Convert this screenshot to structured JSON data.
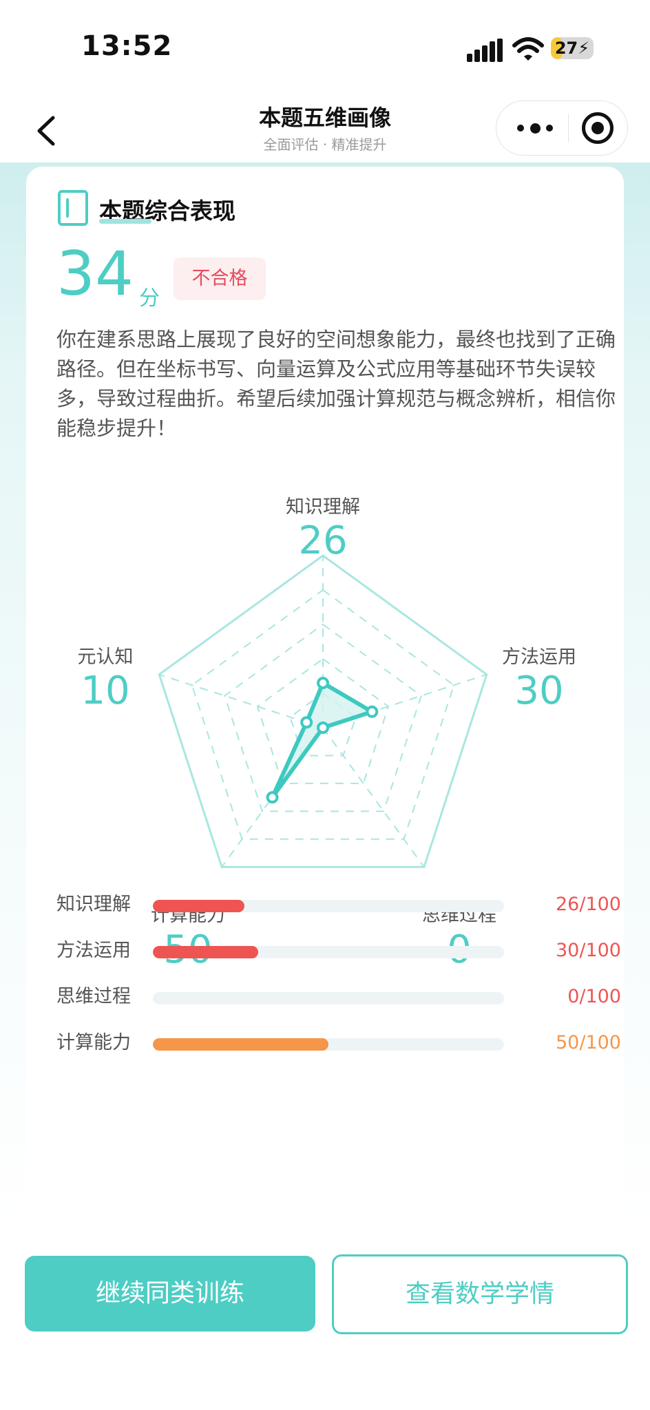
{
  "status_bar": {
    "time": "13:52",
    "battery": "27"
  },
  "nav": {
    "title": "本题五维画像",
    "subtitle": "全面评估 · 精准提升"
  },
  "summary": {
    "section_title": "本题综合表现",
    "score": "34",
    "score_unit": "分",
    "grade": "不合格",
    "comment": "你在建系思路上展现了良好的空间想象能力，最终也找到了正确路径。但在坐标书写、向量运算及公式应用等基础环节失误较多，导致过程曲折。希望后续加强计算规范与概念辨析，相信你能稳步提升！"
  },
  "chart_data": {
    "type": "radar",
    "range": [
      0,
      100
    ],
    "levels": 5,
    "axes": [
      {
        "name": "知识理解",
        "value": 26
      },
      {
        "name": "方法运用",
        "value": 30
      },
      {
        "name": "思维过程",
        "value": 0
      },
      {
        "name": "计算能力",
        "value": 50
      },
      {
        "name": "元认知",
        "value": 10
      }
    ],
    "colors": {
      "line": "#3ec9c0",
      "fill": "#d3f2ef",
      "grid": "#a9e6e1"
    }
  },
  "bars": [
    {
      "label": "知识理解",
      "value": 26,
      "value_text": "26/100",
      "color": "#ee5452"
    },
    {
      "label": "方法运用",
      "value": 30,
      "value_text": "30/100",
      "color": "#ee5452"
    },
    {
      "label": "思维过程",
      "value": 0,
      "value_text": "0/100",
      "color": "#ee5452"
    },
    {
      "label": "计算能力",
      "value": 50,
      "value_text": "50/100",
      "color": "#f59648"
    }
  ],
  "actions": {
    "primary": "继续同类训练",
    "secondary": "查看数学学情"
  },
  "theme": {
    "accent": "#4ecdc4"
  }
}
